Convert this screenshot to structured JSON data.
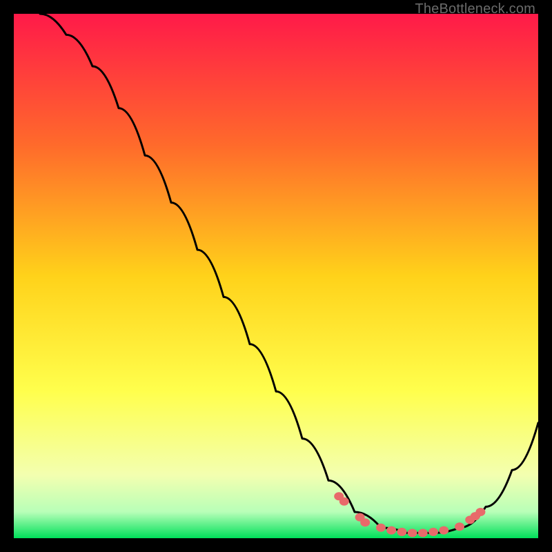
{
  "watermark": "TheBottleneck.com",
  "chart_data": {
    "type": "line",
    "title": "",
    "xlabel": "",
    "ylabel": "",
    "xlim": [
      0,
      100
    ],
    "ylim": [
      0,
      100
    ],
    "gradient_stops": [
      {
        "offset": 0,
        "color": "#ff1a49"
      },
      {
        "offset": 25,
        "color": "#ff6a2b"
      },
      {
        "offset": 50,
        "color": "#ffd21a"
      },
      {
        "offset": 72,
        "color": "#ffff4d"
      },
      {
        "offset": 88,
        "color": "#f3ffb0"
      },
      {
        "offset": 95,
        "color": "#b8ffb8"
      },
      {
        "offset": 100,
        "color": "#00e05a"
      }
    ],
    "curve": [
      {
        "x": 5,
        "y": 100
      },
      {
        "x": 10,
        "y": 96
      },
      {
        "x": 15,
        "y": 90
      },
      {
        "x": 20,
        "y": 82
      },
      {
        "x": 25,
        "y": 73
      },
      {
        "x": 30,
        "y": 64
      },
      {
        "x": 35,
        "y": 55
      },
      {
        "x": 40,
        "y": 46
      },
      {
        "x": 45,
        "y": 37
      },
      {
        "x": 50,
        "y": 28
      },
      {
        "x": 55,
        "y": 19
      },
      {
        "x": 60,
        "y": 11
      },
      {
        "x": 65,
        "y": 5
      },
      {
        "x": 70,
        "y": 2
      },
      {
        "x": 75,
        "y": 1
      },
      {
        "x": 80,
        "y": 1
      },
      {
        "x": 85,
        "y": 2
      },
      {
        "x": 90,
        "y": 6
      },
      {
        "x": 95,
        "y": 13
      },
      {
        "x": 100,
        "y": 22
      }
    ],
    "markers": [
      {
        "x": 62,
        "y": 8
      },
      {
        "x": 63,
        "y": 7
      },
      {
        "x": 66,
        "y": 4
      },
      {
        "x": 67,
        "y": 3
      },
      {
        "x": 70,
        "y": 2
      },
      {
        "x": 72,
        "y": 1.5
      },
      {
        "x": 74,
        "y": 1.2
      },
      {
        "x": 76,
        "y": 1
      },
      {
        "x": 78,
        "y": 1
      },
      {
        "x": 80,
        "y": 1.2
      },
      {
        "x": 82,
        "y": 1.5
      },
      {
        "x": 85,
        "y": 2.2
      },
      {
        "x": 87,
        "y": 3.5
      },
      {
        "x": 88,
        "y": 4.2
      },
      {
        "x": 89,
        "y": 5
      }
    ],
    "marker_color": "#e86a6a"
  }
}
